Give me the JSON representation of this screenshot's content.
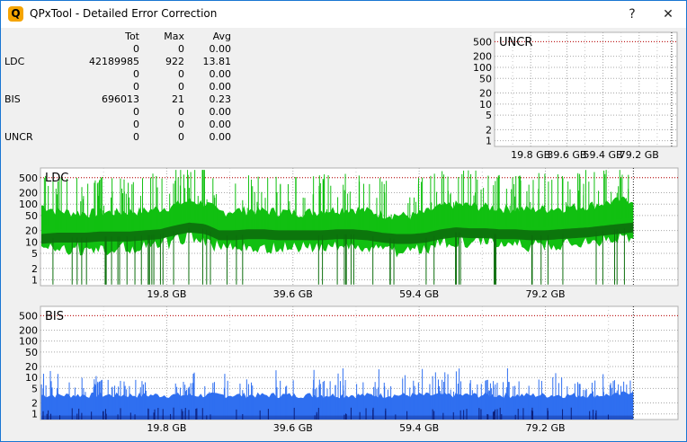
{
  "window": {
    "title": "QPxTool - Detailed Error Correction",
    "app_icon_letter": "Q",
    "help_label": "?",
    "close_label": "✕"
  },
  "stats_table": {
    "headers": [
      "",
      "Tot",
      "Max",
      "Avg"
    ],
    "rows": [
      [
        "",
        "0",
        "0",
        "0.00"
      ],
      [
        "LDC",
        "42189985",
        "922",
        "13.81"
      ],
      [
        "",
        "0",
        "0",
        "0.00"
      ],
      [
        "",
        "0",
        "0",
        "0.00"
      ],
      [
        "BIS",
        "696013",
        "21",
        "0.23"
      ],
      [
        "",
        "0",
        "0",
        "0.00"
      ],
      [
        "",
        "0",
        "0",
        "0.00"
      ],
      [
        "UNCR",
        "0",
        "0",
        "0.00"
      ]
    ]
  },
  "colors": {
    "ldc_light": "#11c011",
    "ldc_dark": "#0c6e0c",
    "bis_light": "#2f6ff0",
    "bis_dark": "#0c1f7a",
    "threshold": "#c00000"
  },
  "chart_data": [
    {
      "type": "area",
      "title": "UNCR",
      "y_scale": "log",
      "y_ticks": [
        "500",
        "200",
        "100",
        "50",
        "20",
        "10",
        "5",
        "2",
        "1"
      ],
      "x_ticks": [
        "19.8 GB",
        "39.6 GB",
        "59.4 GB",
        "79.2 GB"
      ],
      "xlim": [
        0,
        100
      ],
      "threshold": 500,
      "series": [
        {
          "values": [
            0
          ]
        }
      ]
    },
    {
      "type": "area",
      "title": "LDC",
      "y_scale": "log",
      "y_ticks": [
        "500",
        "200",
        "100",
        "50",
        "20",
        "10",
        "5",
        "2",
        "1"
      ],
      "x_ticks": [
        "19.8 GB",
        "39.6 GB",
        "59.4 GB",
        "79.2 GB"
      ],
      "xlim": [
        0,
        100
      ],
      "threshold": 500,
      "data_end_gb": 93,
      "series": [
        {
          "values": [
            30,
            22,
            20,
            19,
            20,
            20,
            21,
            22,
            25,
            30,
            40,
            35,
            20,
            22,
            23,
            22,
            21,
            20,
            20,
            22,
            24,
            25,
            22,
            18,
            17,
            16,
            20,
            28,
            32,
            30,
            28,
            26,
            25,
            24,
            25,
            26,
            28,
            30,
            35,
            40,
            45
          ]
        },
        {
          "values": [
            12,
            13,
            13,
            13,
            14,
            14,
            14,
            15,
            16,
            20,
            24,
            22,
            15,
            15,
            16,
            16,
            15,
            15,
            15,
            15,
            16,
            16,
            15,
            13,
            12,
            12,
            13,
            16,
            18,
            17,
            17,
            16,
            16,
            15,
            15,
            16,
            17,
            18,
            20,
            22,
            24
          ]
        }
      ]
    },
    {
      "type": "area",
      "title": "BIS",
      "y_scale": "log",
      "y_ticks": [
        "500",
        "200",
        "100",
        "50",
        "20",
        "10",
        "5",
        "2",
        "1"
      ],
      "x_ticks": [
        "19.8 GB",
        "39.6 GB",
        "59.4 GB",
        "79.2 GB"
      ],
      "xlim": [
        0,
        100
      ],
      "threshold": 500,
      "data_end_gb": 93,
      "series": [
        {
          "values": [
            3,
            3,
            3,
            3,
            3,
            3,
            3,
            3,
            3,
            3,
            3,
            3,
            3,
            3,
            3,
            3,
            3,
            3,
            3,
            3,
            3,
            3,
            3,
            3,
            3,
            3,
            3,
            3,
            3,
            3,
            3,
            3,
            3,
            3,
            3,
            3,
            3,
            3,
            3,
            3,
            4
          ]
        },
        {
          "values": [
            0.5,
            0.5,
            0.5,
            0.5,
            0.5,
            0.5,
            0.5,
            0.5,
            0.5,
            0.5,
            0.5,
            0.5,
            0.5,
            0.5,
            0.5,
            0.5,
            0.5,
            0.5,
            0.5,
            0.5,
            0.5,
            0.5,
            0.5,
            0.5,
            0.5,
            0.5,
            0.5,
            0.5,
            0.5,
            0.5,
            0.5,
            0.5,
            0.5,
            0.5,
            0.5,
            0.5,
            0.5,
            0.5,
            0.5,
            0.5,
            0.5
          ]
        }
      ]
    }
  ]
}
